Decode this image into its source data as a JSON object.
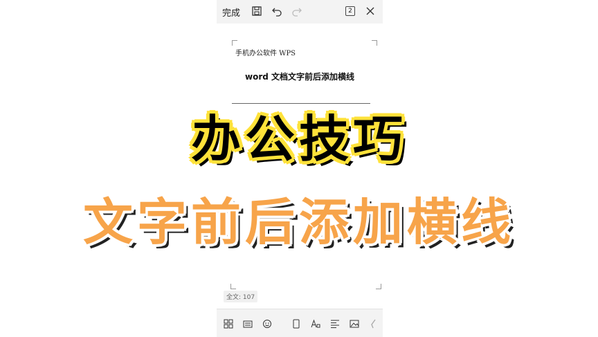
{
  "toolbar": {
    "done_label": "完成",
    "page_count": "2",
    "icons": [
      "save-icon",
      "undo-icon",
      "redo-icon",
      "page-count-icon",
      "close-icon"
    ]
  },
  "document": {
    "line1": "手机办公软件 WPS",
    "heading": "word 文档文字前后添加横线"
  },
  "status": {
    "word_count": "全文: 107"
  },
  "bottom_toolbar": {
    "icons": [
      "grid-icon",
      "keyboard-icon",
      "emoji-icon",
      "page-icon",
      "font-icon",
      "align-icon",
      "image-icon",
      "pen-icon"
    ]
  },
  "overlay": {
    "title1": "办公技巧",
    "title2": "文字前后添加横线"
  },
  "colors": {
    "title1_outline": "#ffe23a",
    "title2_fill": "#f7a44a"
  }
}
